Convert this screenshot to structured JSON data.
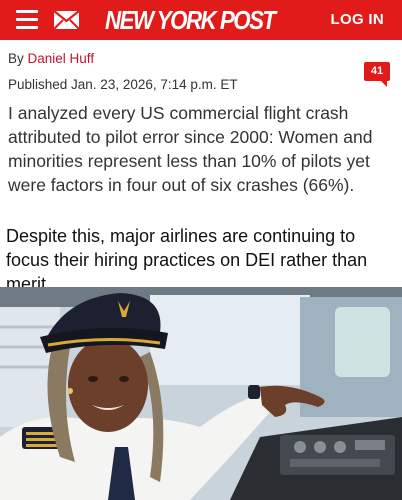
{
  "header": {
    "brand": "NEW YORK POST",
    "login_label": "LOG IN",
    "icons": [
      "menu-icon",
      "mail-icon"
    ],
    "bg_color": "#e11a1a"
  },
  "article": {
    "byline_prefix": "By",
    "author": "Daniel Huff",
    "published": "Published Jan. 23, 2026, 7:14 p.m. ET",
    "comment_count": "41",
    "headline": "I analyzed every US commercial flight crash attributed to pilot error since 2000: Women and minorities represent less than 10% of pilots yet were factors in four out of six crashes (66%).",
    "caption": "Despite this, major airlines are continuing to focus their hiring practices on DEI rather than merit."
  },
  "photo": {
    "alt_icon": "pilot-photo"
  }
}
